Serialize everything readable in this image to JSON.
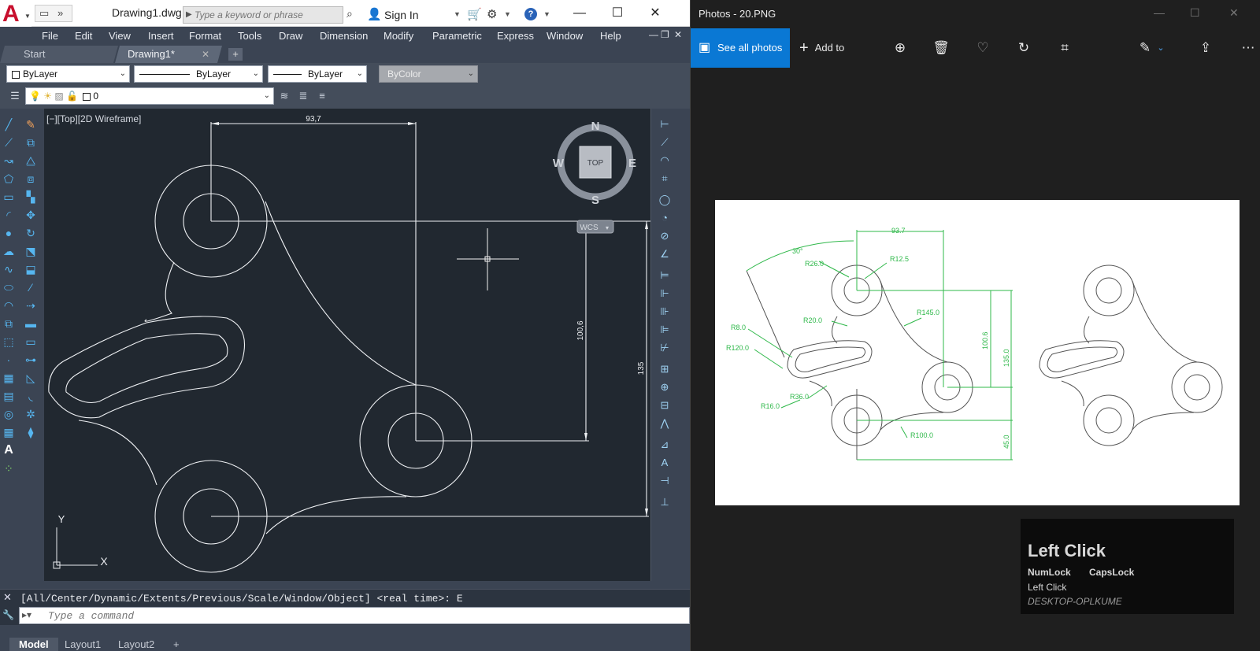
{
  "acad": {
    "title": "Drawing1.dwg",
    "search_placeholder": "Type a keyword or phrase",
    "sign_in": "Sign In",
    "menu": [
      "File",
      "Edit",
      "View",
      "Insert",
      "Format",
      "Tools",
      "Draw",
      "Dimension",
      "Modify",
      "Parametric",
      "Express",
      "Window",
      "Help"
    ],
    "file_tabs": {
      "start": "Start",
      "doc": "Drawing1*"
    },
    "props": {
      "layer": "ByLayer",
      "linetype": "ByLayer",
      "lineweight": "ByLayer",
      "plotstyle": "ByColor",
      "current_layer": "0"
    },
    "viewport": {
      "label": "[−][Top][2D Wireframe]",
      "dims": {
        "horiz": "93,7",
        "vert_inner": "100,6",
        "vert_outer": "135"
      },
      "viewcube": {
        "top": "TOP",
        "n": "N",
        "s": "S",
        "e": "E",
        "w": "W",
        "wcs": "WCS"
      },
      "ucs": {
        "x": "X",
        "y": "Y"
      }
    },
    "command_history": "[All/Center/Dynamic/Extents/Previous/Scale/Window/Object] <real time>: E",
    "command_placeholder": "Type a command",
    "layout_tabs": [
      "Model",
      "Layout1",
      "Layout2"
    ]
  },
  "photos": {
    "title": "Photos - 20.PNG",
    "see_all": "See all photos",
    "add_to": "Add to",
    "icons": [
      "zoom-in-icon",
      "delete-icon",
      "favorite-icon",
      "rotate-icon",
      "crop-icon",
      "edit-icon",
      "share-icon",
      "more-icon"
    ],
    "image_labels": {
      "angle": "30°",
      "d93": "93.7",
      "r26": "R26.0",
      "r125": "R12.5",
      "r145": "R145.0",
      "r20": "R20.0",
      "r8": "R8.0",
      "r120": "R120.0",
      "d1006": "100.6",
      "d135": "135.0",
      "r36": "R36.0",
      "r16": "R16.0",
      "r100": "R100.0",
      "d45": "45.0"
    }
  },
  "overlay": {
    "heading": "Left Click",
    "numlock": "NumLock",
    "capslock": "CapsLock",
    "event": "Left Click",
    "host": "DESKTOP-OPLKUME"
  },
  "colors": {
    "acad_bg": "#212830",
    "photos_accent": "#0a78d4",
    "dim_green": "#2fb84a"
  }
}
